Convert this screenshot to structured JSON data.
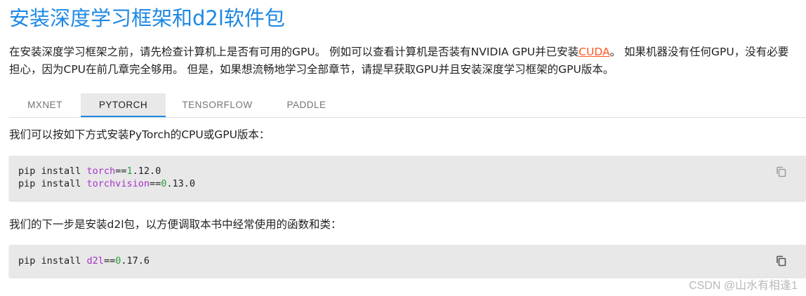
{
  "page": {
    "title": "安装深度学习框架和d2l软件包",
    "intro_text_1": "在安装深度学习框架之前，请先检查计算机上是否有可用的GPU。 例如可以查看计算机是否装有NVIDIA GPU并已安装",
    "intro_link": "CUDA",
    "intro_text_2": "。 如果机器没有任何GPU，没有必要担心，因为CPU在前几章完全够用。 但是，如果想流畅地学习全部章节，请提早获取GPU并且安装深度学习框架的GPU版本。"
  },
  "tabs": [
    {
      "label": "MXNET",
      "active": false
    },
    {
      "label": "PYTORCH",
      "active": true
    },
    {
      "label": "TENSORFLOW",
      "active": false
    },
    {
      "label": "PADDLE",
      "active": false
    }
  ],
  "content": {
    "paragraph_1": "我们可以按如下方式安装PyTorch的CPU或GPU版本：",
    "code_block_1": {
      "line_1": {
        "prefix": "pip install ",
        "package": "torch",
        "op": "==",
        "major": "1",
        "rest": ".12.0"
      },
      "line_2": {
        "prefix": "pip install ",
        "package": "torchvision",
        "op": "==",
        "major": "0",
        "rest": ".13.0"
      }
    },
    "paragraph_2": "我们的下一步是安装d2l包，以方便调取本书中经常使用的函数和类：",
    "code_block_2": {
      "line_1": {
        "prefix": "pip install ",
        "package": "d2l",
        "op": "==",
        "major": "0",
        "rest": ".17.6"
      }
    }
  },
  "icons": {
    "copy": "copy-icon"
  },
  "colors": {
    "title": "#1e88e5",
    "link": "#ff5722",
    "tab_active_bg": "#e9e9e9",
    "tab_indicator": "#1e88e5",
    "code_bg": "#e8e8e8",
    "code_keyword": "#a832c8",
    "code_number": "#2e9d3e"
  },
  "watermark": "CSDN @山水有相逢1"
}
